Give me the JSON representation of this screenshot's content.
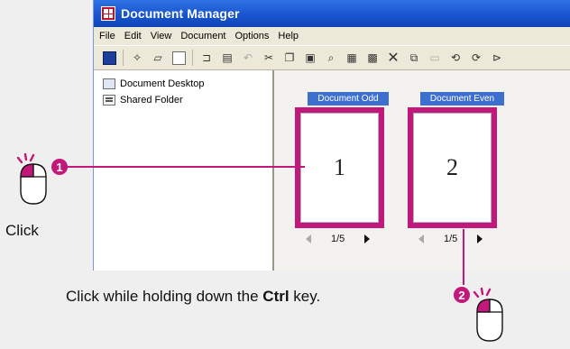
{
  "window": {
    "title": "Document Manager",
    "menu": [
      "File",
      "Edit",
      "View",
      "Document",
      "Options",
      "Help"
    ],
    "toolbar_icons": [
      "document-icon",
      "new-icon",
      "open-icon",
      "save-icon",
      "fax-icon",
      "print-icon",
      "undo-icon",
      "cut-icon",
      "copy-icon",
      "paste-icon",
      "find-icon",
      "view-icon",
      "thumbnail-icon",
      "delete-icon",
      "duplicate-icon",
      "properties-icon",
      "rotate-left-icon",
      "rotate-right-icon",
      "rotate-icon"
    ]
  },
  "tree": {
    "items": [
      {
        "label": "Document Desktop",
        "icon": "desktop-icon"
      },
      {
        "label": "Shared Folder",
        "icon": "shared-folder-icon"
      }
    ]
  },
  "documents": [
    {
      "label": "Document Odd",
      "page": "1",
      "pager": "1/5"
    },
    {
      "label": "Document Even",
      "page": "2",
      "pager": "1/5"
    }
  ],
  "annotations": {
    "step1_number": "1",
    "step1_label": "Click",
    "step2_number": "2",
    "step2_text_before": "Click while holding down the ",
    "step2_key": "Ctrl",
    "step2_text_after": " key.",
    "accent": "#c2187a"
  }
}
